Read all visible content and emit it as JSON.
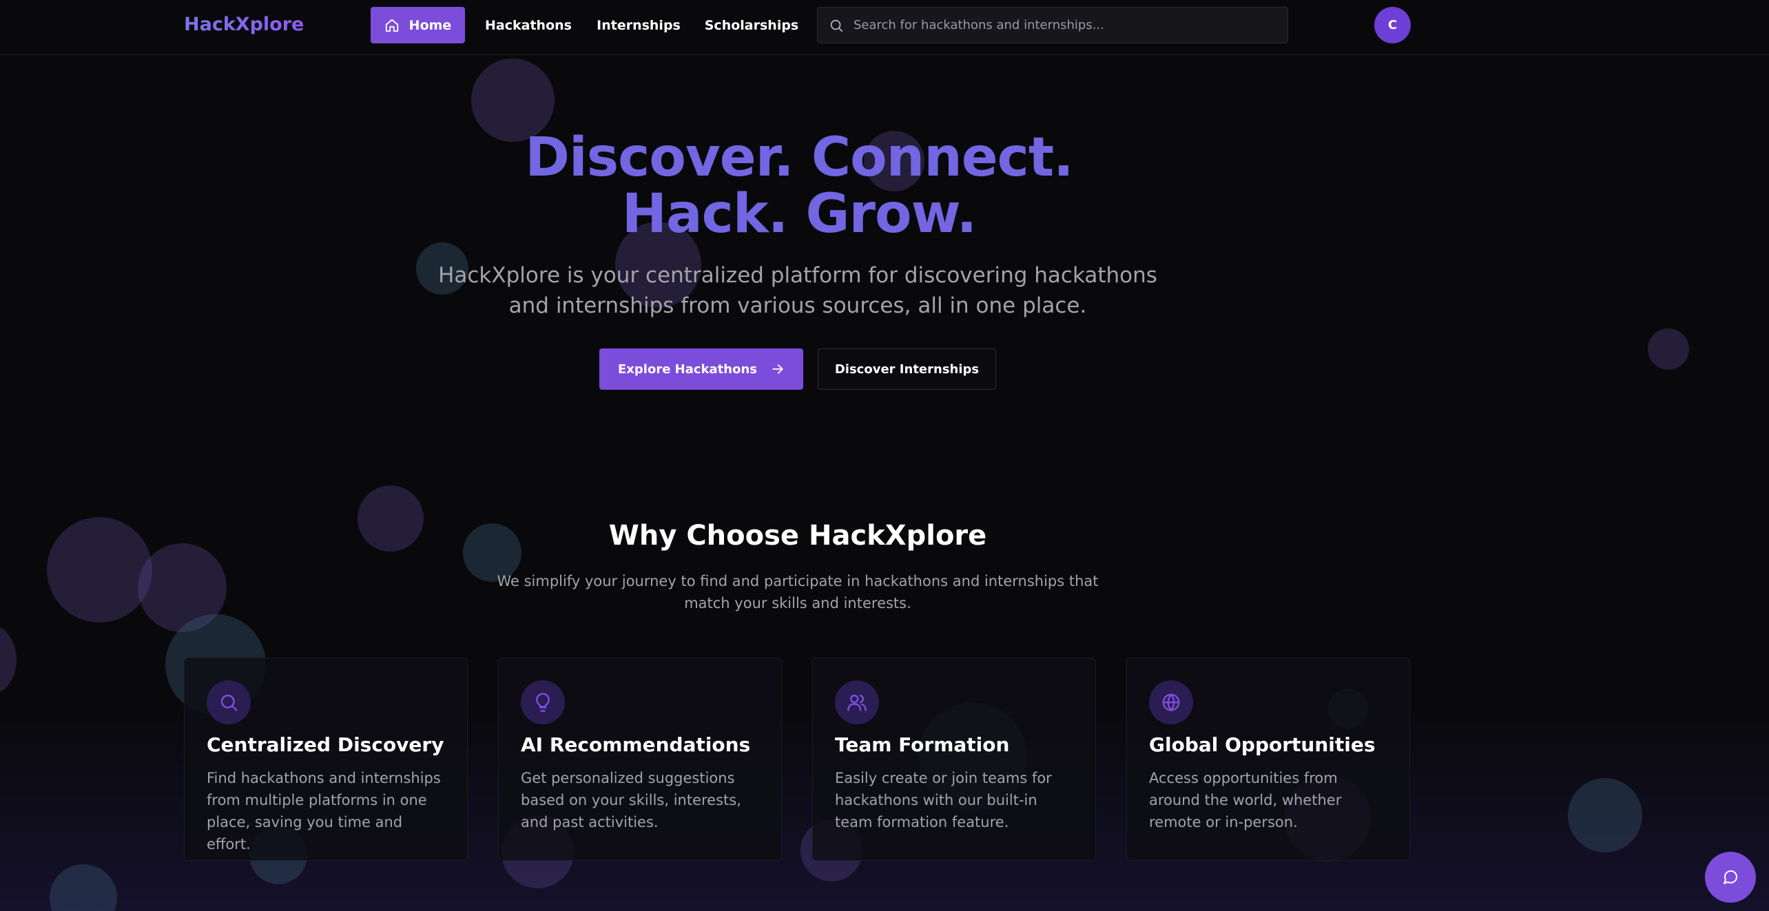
{
  "brand": {
    "name": "HackXplore"
  },
  "nav": {
    "items": [
      {
        "label": "Home",
        "icon": "home-icon",
        "active": true
      },
      {
        "label": "Hackathons"
      },
      {
        "label": "Internships"
      },
      {
        "label": "Scholarships"
      }
    ]
  },
  "search": {
    "placeholder": "Search for hackathons and internships..."
  },
  "user": {
    "avatar_initial": "C"
  },
  "hero": {
    "title_line1": "Discover. Connect.",
    "title_line2": "Hack. Grow.",
    "subtitle": "HackXplore is your centralized platform for discovering hackathons and internships from various sources, all in one place.",
    "primary_button": "Explore Hackathons",
    "secondary_button": "Discover Internships"
  },
  "why": {
    "title": "Why Choose HackXplore",
    "subtitle": "We simplify your journey to find and participate in hackathons and internships that match your skills and interests."
  },
  "features": [
    {
      "icon": "search-icon",
      "title": "Centralized Discovery",
      "text": "Find hackathons and internships from multiple platforms in one place, saving you time and effort."
    },
    {
      "icon": "lightbulb-icon",
      "title": "AI Recommendations",
      "text": "Get personalized suggestions based on your skills, interests, and past activities."
    },
    {
      "icon": "users-icon",
      "title": "Team Formation",
      "text": "Easily create or join teams for hackathons with our built-in team formation feature."
    },
    {
      "icon": "globe-icon",
      "title": "Global Opportunities",
      "text": "Access opportunities from around the world, whether remote or in-person."
    }
  ],
  "chat": {
    "icon": "chat-icon"
  },
  "colors": {
    "accent": "#7c4ddb",
    "hero_title": "#7266e2",
    "background": "#09090c",
    "muted_text": "#a3a3ab"
  }
}
